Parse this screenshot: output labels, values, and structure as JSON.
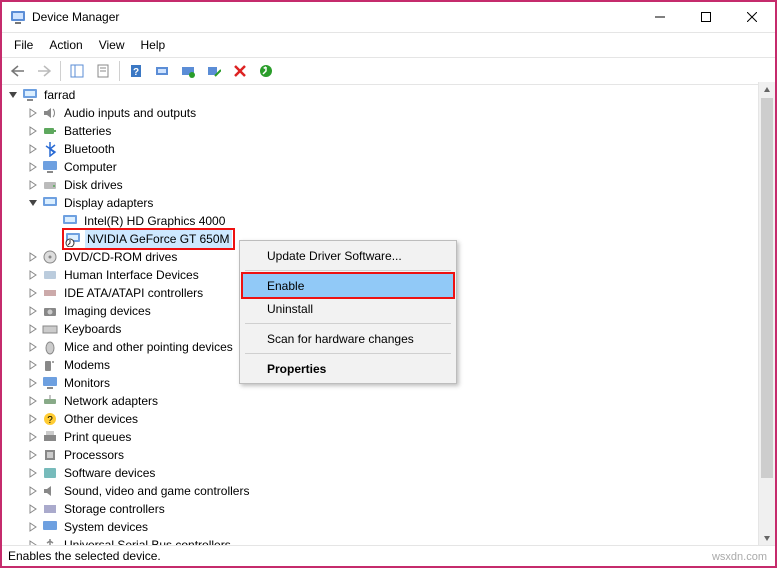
{
  "window": {
    "title": "Device Manager"
  },
  "menu": {
    "file": "File",
    "action": "Action",
    "view": "View",
    "help": "Help"
  },
  "tree": {
    "root": "farrad",
    "audio": "Audio inputs and outputs",
    "batteries": "Batteries",
    "bluetooth": "Bluetooth",
    "computer": "Computer",
    "disk": "Disk drives",
    "display": "Display adapters",
    "intel": "Intel(R) HD Graphics 4000",
    "nvidia": "NVIDIA GeForce GT 650M",
    "dvd": "DVD/CD-ROM drives",
    "hid": "Human Interface Devices",
    "ide": "IDE ATA/ATAPI controllers",
    "imaging": "Imaging devices",
    "keyboards": "Keyboards",
    "mice": "Mice and other pointing devices",
    "modems": "Modems",
    "monitors": "Monitors",
    "network": "Network adapters",
    "other": "Other devices",
    "print": "Print queues",
    "processors": "Processors",
    "software": "Software devices",
    "sound": "Sound, video and game controllers",
    "storage": "Storage controllers",
    "system": "System devices",
    "usb": "Universal Serial Bus controllers"
  },
  "context": {
    "update": "Update Driver Software...",
    "enable": "Enable",
    "uninstall": "Uninstall",
    "scan": "Scan for hardware changes",
    "properties": "Properties"
  },
  "status": "Enables the selected device.",
  "watermark": "wsxdn.com"
}
